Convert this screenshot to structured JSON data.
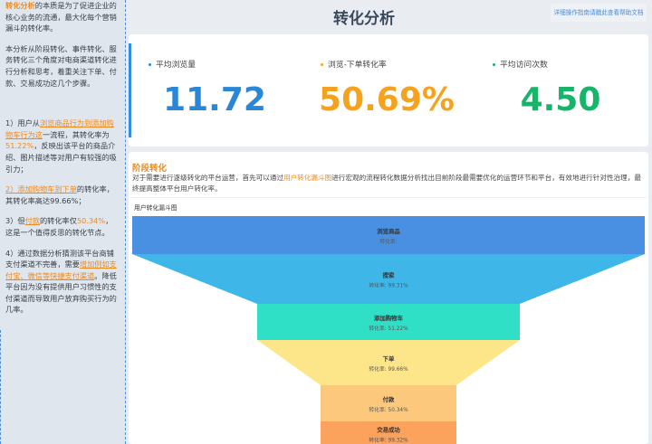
{
  "sidebar": {
    "intro_a_highlight": "转化分析",
    "intro_a_text": "的本质是为了促进企业的核心业务的流通，最大化每个营销漏斗的转化率。",
    "intro_b": "本分析从阶段转化、事件转化、服务转化三个角度对电商渠道转化进行分析和思考，着重关注下单、付款、交易成功这几个步骤。",
    "p1_pre": "1）用户从",
    "p1_link": "浏览商品行为到添加购物车行为这",
    "p1_mid": "一流程，其转化率为",
    "p1_rate": "51.22%",
    "p1_post": "，反映出该平台的商品介绍、图片描述等对用户有较强的吸引力；",
    "p2_link": "2）添加购物车到下单",
    "p2_post": "的转化率，其转化率高达99.66%；",
    "p3_pre": "3）但",
    "p3_link": "付款",
    "p3_mid": "的转化率仅",
    "p3_rate": "50.34%",
    "p3_post": "，这是一个值得反思的转化节点。",
    "p4_pre": "4）通过数据分析猜测该平台商铺支付渠道不完善，需要",
    "p4_link": "增加例如支付宝、微信等快捷支付渠道",
    "p4_post": "。降低平台因为没有提供用户习惯性的支付渠道而导致用户放弃购买行为的几率。"
  },
  "header": {
    "title": "转化分析",
    "help_link": "详细操作指南请戳此查看帮助文档"
  },
  "kpis": [
    {
      "label": "平均浏览量",
      "value": "11.72",
      "color": "#2a86d6"
    },
    {
      "label": "浏览-下单转化率",
      "value": "50.69%",
      "color": "#f5a21f"
    },
    {
      "label": "平均访问次数",
      "value": "4.50",
      "color": "#16b56a"
    }
  ],
  "section": {
    "title": "阶段转化",
    "desc_pre": "对于需要进行逐级转化的平台运营，首先可以通过",
    "desc_link": "用户转化漏斗图",
    "desc_post": "进行宏观的流程转化数据分析找出目前阶段最需要优化的运营环节和平台，有效地进行针对性治理，最终提高整体平台用户转化率。",
    "chart_title": "用户转化漏斗图"
  },
  "chart_data": {
    "type": "funnel",
    "title": "用户转化漏斗图",
    "rate_label": "转化率:",
    "stages": [
      {
        "name": "浏览商品",
        "rate": "",
        "color": "#4a90e2"
      },
      {
        "name": "搜索",
        "rate": "99.31%",
        "color": "#3fb6e8"
      },
      {
        "name": "添加购物车",
        "rate": "51.22%",
        "color": "#2fe0c7"
      },
      {
        "name": "下单",
        "rate": "99.66%",
        "color": "#fde68a"
      },
      {
        "name": "付款",
        "rate": "50.34%",
        "color": "#fcc97c"
      },
      {
        "name": "交易成功",
        "rate": "99.32%",
        "color": "#fba25c"
      }
    ]
  }
}
